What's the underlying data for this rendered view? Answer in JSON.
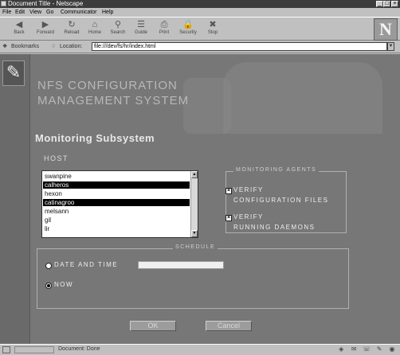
{
  "window": {
    "title": "Document Title - Netscape"
  },
  "menu": [
    "File",
    "Edit",
    "View",
    "Go",
    "Communicator",
    "Help"
  ],
  "toolbar": [
    {
      "label": "Back",
      "icon": "back-arrow-icon",
      "glyph": "◀"
    },
    {
      "label": "Forward",
      "icon": "forward-arrow-icon",
      "glyph": "▶"
    },
    {
      "label": "Reload",
      "icon": "reload-icon",
      "glyph": "↻"
    },
    {
      "label": "Home",
      "icon": "home-icon",
      "glyph": "⌂"
    },
    {
      "label": "Search",
      "icon": "search-icon",
      "glyph": "⚲"
    },
    {
      "label": "Guide",
      "icon": "guide-icon",
      "glyph": "☰"
    },
    {
      "label": "Print",
      "icon": "print-icon",
      "glyph": "⎙"
    },
    {
      "label": "Security",
      "icon": "lock-icon",
      "glyph": "🔒"
    },
    {
      "label": "Stop",
      "icon": "stop-icon",
      "glyph": "✖"
    }
  ],
  "location": {
    "bookmarks_label": "Bookmarks",
    "location_label": "Location:",
    "url": "file:///dev/fs/hr/index.html"
  },
  "app": {
    "title_line1": "NFS CONFIGURATION",
    "title_line2": "MANAGEMENT SYSTEM",
    "subtitle": "Monitoring Subsystem",
    "host_label": "HOST",
    "hosts": [
      {
        "name": "swanpine",
        "selected": false
      },
      {
        "name": "calheros",
        "selected": true
      },
      {
        "name": "hexon",
        "selected": false
      },
      {
        "name": "catinagroo",
        "selected": true
      },
      {
        "name": "melsann",
        "selected": false
      },
      {
        "name": "gil",
        "selected": false
      },
      {
        "name": "lir",
        "selected": false
      }
    ],
    "agents_legend": "MONITORING AGENTS",
    "agents": [
      {
        "line1": "VERIFY",
        "line2": "CONFIGURATION FILES",
        "checked": true
      },
      {
        "line1": "VERIFY",
        "line2": "RUNNING DAEMONS",
        "checked": true
      }
    ],
    "schedule_legend": "SCHEDULE",
    "schedule": [
      {
        "label": "DATE AND TIME",
        "selected": false
      },
      {
        "label": "NOW",
        "selected": true
      }
    ],
    "date_time_value": "",
    "ok_label": "OK",
    "cancel_label": "Cancel"
  },
  "status": {
    "text": "Document: Done"
  }
}
